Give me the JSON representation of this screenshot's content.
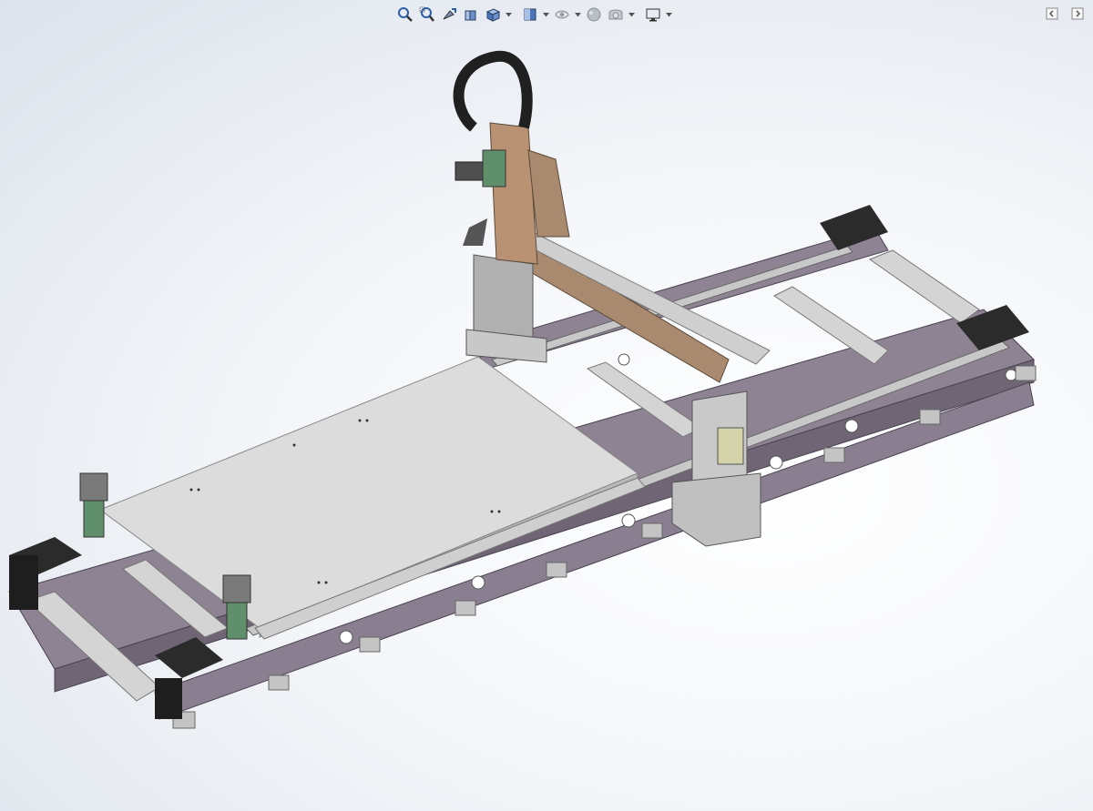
{
  "heads_up_toolbar": {
    "icons": [
      "zoom-to-fit-icon",
      "zoom-to-area-icon",
      "previous-view-icon",
      "section-view-icon",
      "view-orientation-icon",
      "display-style-icon",
      "hide-show-items-icon",
      "edit-appearance-icon",
      "apply-scene-icon",
      "view-settings-icon"
    ]
  },
  "side_tools": {
    "icons": [
      "collapse-left-panel-icon",
      "collapse-right-panel-icon"
    ]
  },
  "colors": {
    "frame": "#8e8393",
    "frame_dark": "#6f6575",
    "table_top": "#d9d9d9",
    "rail": "#c8c8c8",
    "bellows": "#2b2b2b",
    "gantry_wood": "#a98a6e",
    "motor_green": "#5f8f6b",
    "cable_chain": "#202020"
  }
}
